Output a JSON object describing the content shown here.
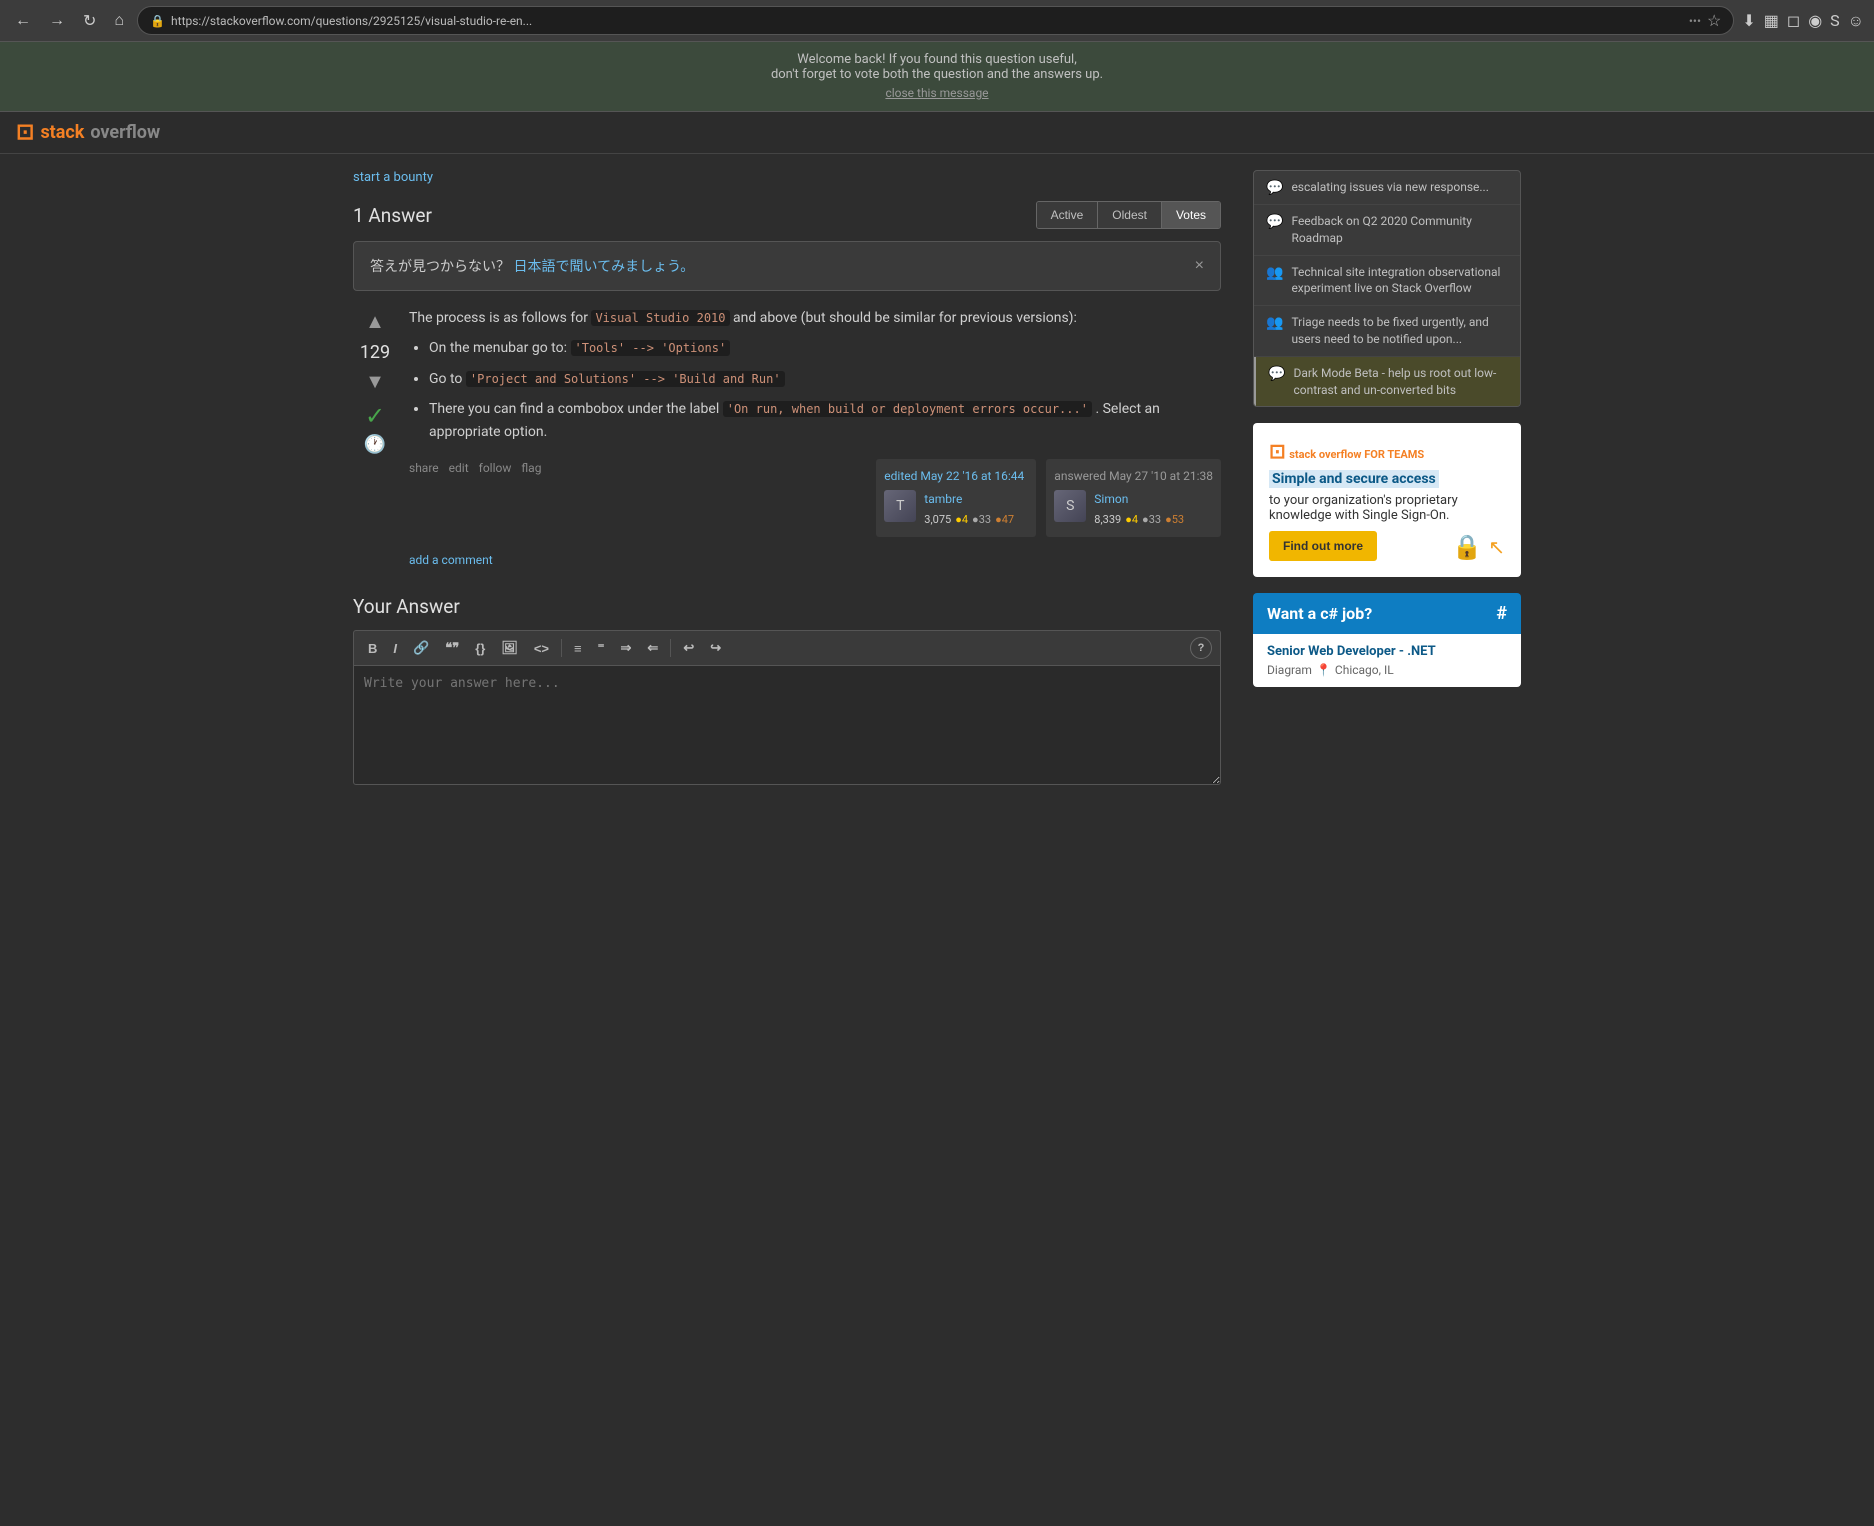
{
  "browser": {
    "url": "https://stackoverflow.com/questions/2925125/visual-studio-re-en...",
    "nav_back": "←",
    "nav_forward": "→",
    "nav_refresh": "↻",
    "nav_home": "⌂"
  },
  "notification": {
    "line1": "Welcome back! If you found this question useful,",
    "line2": "don't forget to vote both the question and the answers up.",
    "close_label": "close this message"
  },
  "bounty": {
    "link_text": "start a bounty"
  },
  "answers_section": {
    "title": "1 Answer",
    "sort_tabs": [
      "Active",
      "Oldest",
      "Votes"
    ],
    "active_tab": "Active"
  },
  "japanese_banner": {
    "text": "答えが見つからない？",
    "link_text": "日本語で聞いてみましょう。",
    "close": "×"
  },
  "answer": {
    "vote_count": "129",
    "body_intro": "The process is as follows for",
    "code_inline_1": "Visual Studio 2010",
    "body_after_code": "and above (but should be similar for previous versions):",
    "bullet_1_prefix": "On the menubar go to:",
    "bullet_1_code": "'Tools' --> 'Options'",
    "bullet_2_prefix": "Go to",
    "bullet_2_code": "'Project and Solutions' --> 'Build and Run'",
    "bullet_3_prefix": "There you can find a combobox under the label",
    "bullet_3_code": "'On run, when build or deployment errors occur...'",
    "bullet_3_suffix": ". Select an appropriate option.",
    "actions": [
      "share",
      "edit",
      "follow",
      "flag"
    ],
    "edited_date": "edited May 22 '16 at 16:44",
    "editor_name": "tambre",
    "editor_rep": "3,075",
    "editor_gold": "4",
    "editor_silver": "33",
    "editor_bronze": "47",
    "answered_date": "answered May 27 '10 at 21:38",
    "answerer_name": "Simon",
    "answerer_rep": "8,339",
    "answerer_gold": "4",
    "answerer_silver": "33",
    "answerer_bronze": "53",
    "add_comment": "add a comment"
  },
  "your_answer": {
    "title": "Your Answer",
    "toolbar_buttons": [
      "B",
      "I",
      "🔗",
      "\"\"",
      "{}",
      "🖼",
      "<>",
      "≡",
      "⁼",
      "⇐",
      "⇒",
      "↩",
      "↪",
      "?"
    ],
    "placeholder": "Write your answer here..."
  },
  "sidebar": {
    "items": [
      {
        "id": "escalating",
        "icon": "💬",
        "text": "escalating issues via new response...",
        "highlighted": false
      },
      {
        "id": "feedback-q2",
        "icon": "💬",
        "text": "Feedback on Q2 2020 Community Roadmap",
        "highlighted": false
      },
      {
        "id": "technical-site",
        "icon": "👥",
        "text": "Technical site integration observational experiment live on Stack Overflow",
        "highlighted": false
      },
      {
        "id": "triage",
        "icon": "👥",
        "text": "Triage needs to be fixed urgently, and users need to be notified upon...",
        "highlighted": false
      },
      {
        "id": "dark-mode",
        "icon": "💬",
        "text": "Dark Mode Beta - help us root out low-contrast and un-converted bits",
        "highlighted": true
      }
    ],
    "ad": {
      "logo": "stack overflow FOR TEAMS",
      "headline": "Simple and secure access",
      "body": "to your organization's proprietary knowledge with Single Sign-On.",
      "cta": "Find out more"
    },
    "jobs_header": "Want a c# job?",
    "jobs_hash": "#",
    "job": {
      "title": "Senior Web Developer - .NET",
      "company": "Diagram",
      "location": "Chicago, IL"
    }
  }
}
